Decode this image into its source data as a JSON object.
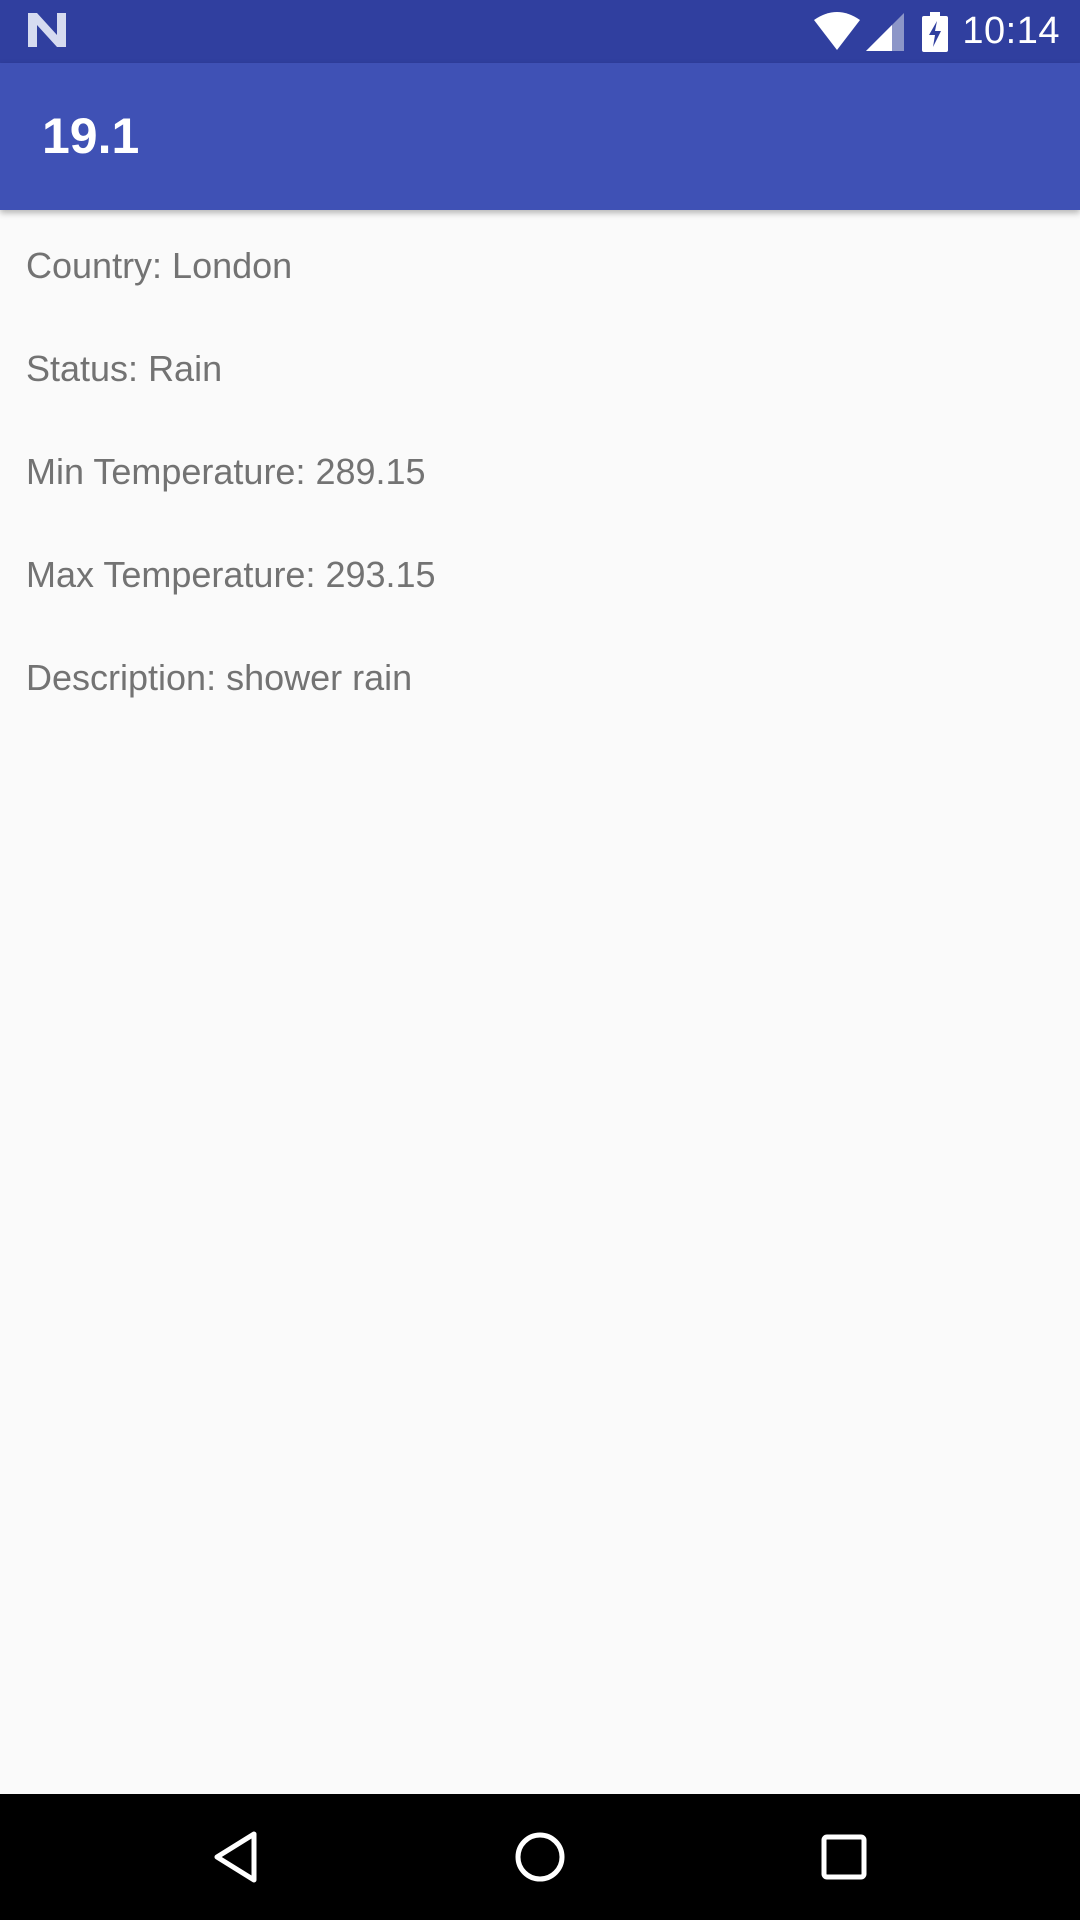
{
  "status_bar": {
    "time": "10:14",
    "icons": [
      "n-logo-icon",
      "wifi-icon",
      "signal-icon",
      "battery-charging-icon"
    ],
    "background": "#303f9f"
  },
  "app_bar": {
    "title": "19.1",
    "background": "#3f51b5"
  },
  "weather": {
    "rows": [
      {
        "label": "Country: London"
      },
      {
        "label": "Status: Rain"
      },
      {
        "label": "Min Temperature: 289.15"
      },
      {
        "label": "Max Temperature: 293.15"
      },
      {
        "label": "Description: shower rain"
      }
    ],
    "text_color": "#737373"
  },
  "nav_bar": {
    "buttons": [
      "back-icon",
      "home-icon",
      "recents-icon"
    ],
    "background": "#000000"
  }
}
